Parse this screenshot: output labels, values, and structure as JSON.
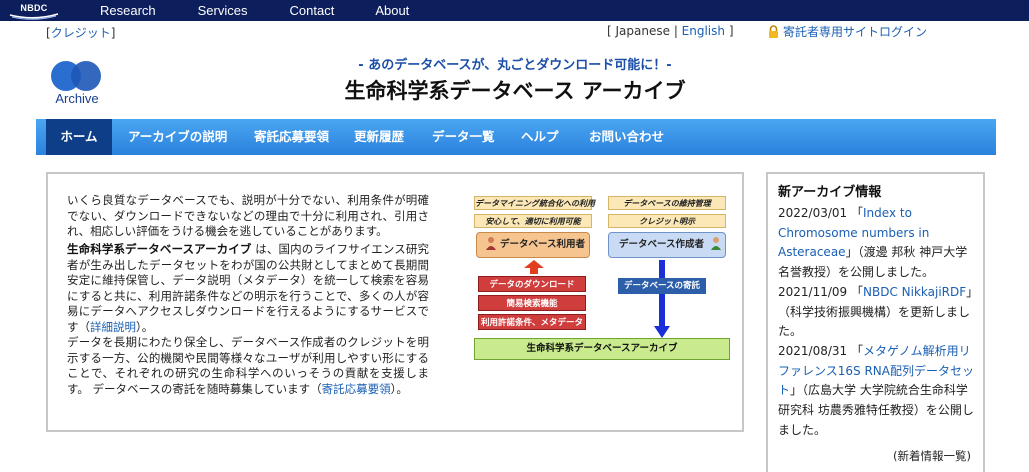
{
  "topbar": {
    "logo": "NBDC",
    "nav": [
      "Research",
      "Services",
      "Contact",
      "About"
    ]
  },
  "header": {
    "credit_link": "クレジット",
    "lang_japanese": "Japanese",
    "lang_english": "English",
    "login": "寄託者専用サイトログイン",
    "logo_label": "Archive",
    "tagline": "- あのデータベースが、丸ごとダウンロード可能に！-",
    "title": "生命科学系データベース アーカイブ"
  },
  "mainnav": [
    "ホーム",
    "アーカイブの説明",
    "寄託応募要領",
    "更新履歴",
    "データ一覧",
    "ヘルプ",
    "お問い合わせ"
  ],
  "content": {
    "p1": "いくら良質なデータベースでも、説明が十分でない、利用条件が明確でない、ダウンロードできないなどの理由で十分に利用され、引用され、相応しい評価をうける機会を逃していることがあります。",
    "p2_bold": "生命科学系データベースアーカイブ",
    "p2_text": " は、国内のライフサイエンス研究者が生み出したデータセットをわが国の公共財としてまとめて長期間安定に維持保管し、データ説明（メタデータ）を統一して検索を容易にすると共に、利用許諾条件などの明示を行うことで、多くの人が容易にデータへアクセスしダウンロードを行えるようにするサービスです（",
    "p2_link": "詳細説明",
    "p2_end": "）。",
    "p3_text": "データを長期にわたり保全し、データベース作成者のクレジットを明示する一方、公的機関や民間等様々なユーザが利用しやすい形にすることで、それぞれの研究の生命科学へのいっそうの貢献を支援します。 データベースの寄託を随時募集しています（",
    "p3_link": "寄託応募要領",
    "p3_end": "）。"
  },
  "diagram": {
    "tag_data_mining": "データマイニング統合化への利用",
    "tag_safe_use": "安心して、適切に利用可能",
    "tag_maintenance": "データベースの維持管理",
    "tag_credit": "クレジット明示",
    "user": "データベース利用者",
    "creator": "データベース作成者",
    "download": "データのダウンロード",
    "search": "簡易検索機能",
    "license": "利用許諾条件、メタデータ",
    "deposit": "データベースの寄託",
    "archive": "生命科学系データベースアーカイブ"
  },
  "sidebar": {
    "title": "新アーカイブ情報",
    "news": [
      {
        "date": "2022/03/01",
        "pre": "「",
        "link": "Index to Chromosome numbers in Asteraceae",
        "post": "」（渡邊 邦秋 神戸大学名誉教授）を公開しました。"
      },
      {
        "date": "2021/11/09",
        "pre": "「",
        "link": "NBDC NikkajiRDF",
        "post": "」（科学技術振興機構）を更新しました。"
      },
      {
        "date": "2021/08/31",
        "pre": "「",
        "link": "メタゲノム解析用リファレンス16S RNA配列データセット",
        "post": "」（広島大学 大学院統合生命科学研究科 坊農秀雅特任教授）を公開しました。"
      }
    ],
    "more": "新着情報一覧"
  },
  "colors": {
    "topbar": "#0c1e5b",
    "nav_gradient_top": "#4aa6f2",
    "nav_active": "#0d3e87",
    "link": "#1a5fb4"
  }
}
